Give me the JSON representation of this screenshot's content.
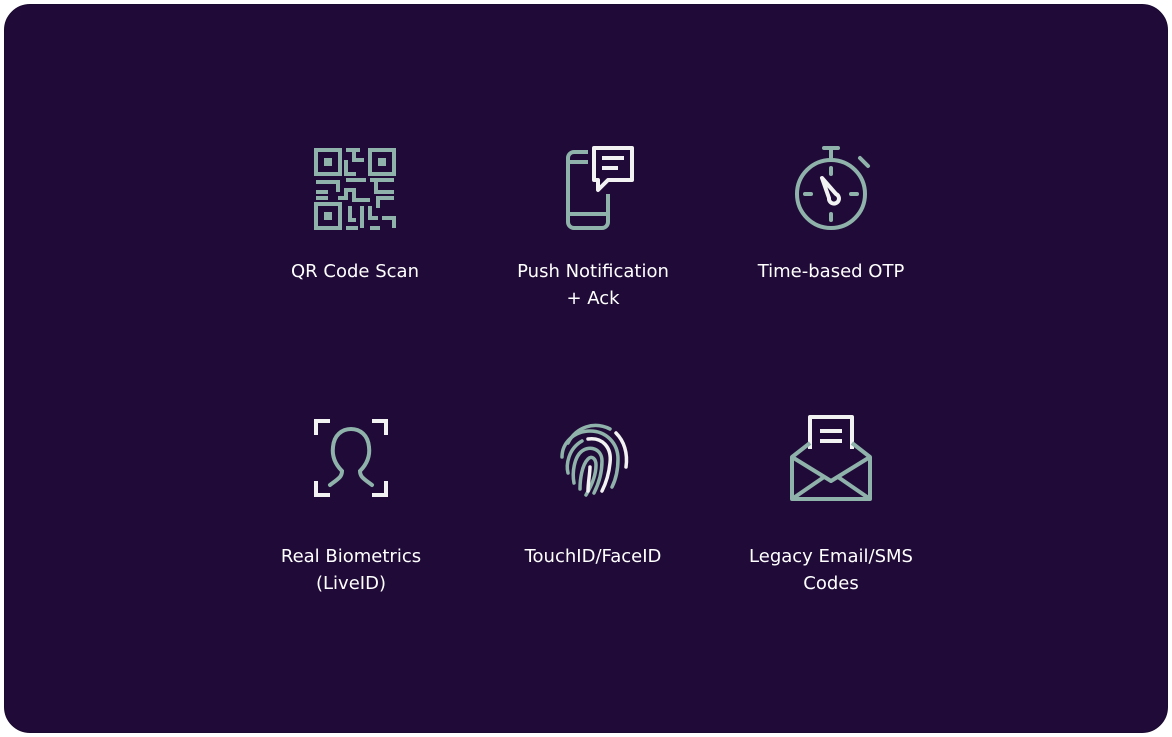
{
  "colors": {
    "background": "#200b38",
    "icon_stroke": "#8fb3ab",
    "icon_accent": "#f2f2f2",
    "text": "#ffffff"
  },
  "methods": [
    {
      "label": "QR Code Scan",
      "icon": "qr-code-icon"
    },
    {
      "label": "Push Notification\n+ Ack",
      "icon": "phone-message-icon"
    },
    {
      "label": "Time-based OTP",
      "icon": "stopwatch-icon"
    },
    {
      "label": "Real Biometrics\n(LiveID)",
      "icon": "face-scan-icon"
    },
    {
      "label": "TouchID/FaceID",
      "icon": "fingerprint-icon"
    },
    {
      "label": "Legacy Email/SMS\nCodes",
      "icon": "envelope-icon"
    }
  ]
}
